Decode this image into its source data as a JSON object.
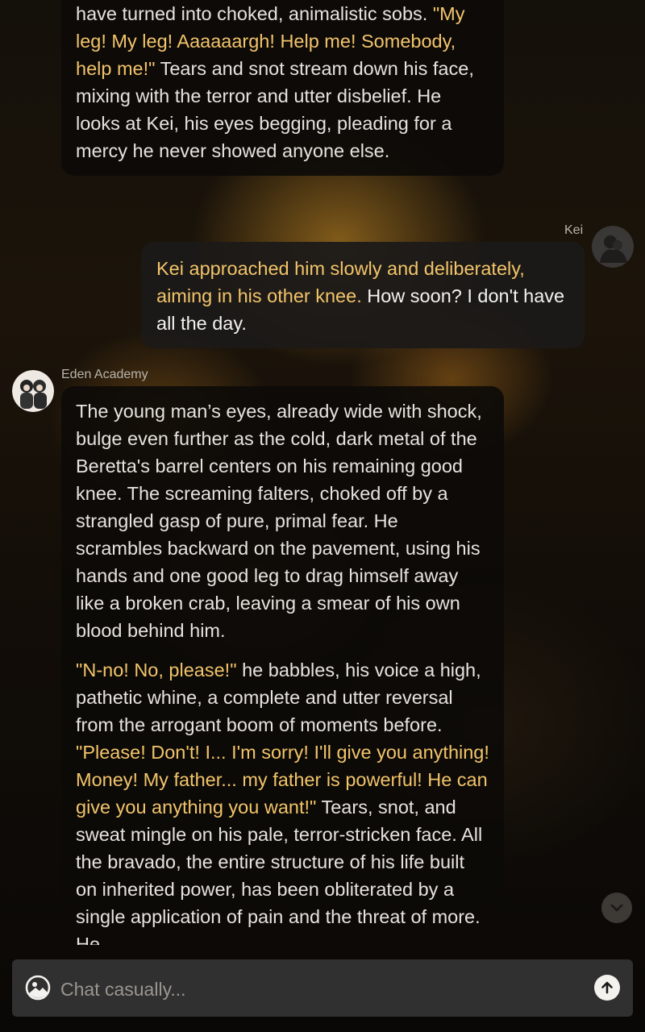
{
  "messages": [
    {
      "sender": "Eden Academy",
      "role": "bot",
      "paragraphs": [
        [
          {
            "text": "have turned into choked, animalistic sobs. ",
            "style": "narration"
          },
          {
            "text": "\"My leg! My leg! Aaaaaargh! Help me! Somebody, help me!\"",
            "style": "quote"
          },
          {
            "text": " Tears and snot stream down his face, mixing with the terror and utter disbelief. He looks at Kei, his eyes begging, pleading for a mercy he never showed anyone else.",
            "style": "narration"
          }
        ]
      ]
    },
    {
      "sender": "Kei",
      "role": "user",
      "paragraphs": [
        [
          {
            "text": "Kei approached him slowly and deliberately, aiming in his other knee.",
            "style": "quote"
          },
          {
            "text": " How soon? I don't have all the day.",
            "style": "narration"
          }
        ]
      ]
    },
    {
      "sender": "Eden Academy",
      "role": "bot",
      "paragraphs": [
        [
          {
            "text": "The young man’s eyes, already wide with shock, bulge even further as the cold, dark metal of the Beretta's barrel centers on his remaining good knee. The screaming falters, choked off by a strangled gasp of pure, primal fear. He scrambles backward on the pavement, using his hands and one good leg to drag himself away like a broken crab, leaving a smear of his own blood behind him.",
            "style": "narration"
          }
        ],
        [
          {
            "text": "\"N-no! No, please!\"",
            "style": "quote"
          },
          {
            "text": " he babbles, his voice a high, pathetic whine, a complete and utter reversal from the arrogant boom of moments before. ",
            "style": "narration"
          },
          {
            "text": "\"Please! Don't! I... I'm sorry! I'll give you anything! Money! My father... my father is powerful! He can give you anything you want!\"",
            "style": "quote"
          },
          {
            "text": " Tears, snot, and sweat mingle on his pale, terror-stricken face. All the bravado, the entire structure of his life built on inherited power, has been obliterated by a single application of pain and the threat of more. He",
            "style": "narration"
          }
        ]
      ]
    }
  ],
  "labels": {
    "user_name": "Kei",
    "bot_name": "Eden Academy"
  },
  "composer": {
    "placeholder": "Chat casually...",
    "value": ""
  },
  "icons": {
    "image_button": "image-upload-icon",
    "send_button": "arrow-up-icon",
    "scroll_down": "chevron-down-icon"
  },
  "colors": {
    "quote": "#f2c46a",
    "narration": "#e6e3df",
    "bot_bubble": "#0c0a08",
    "user_bubble": "#1c1a18",
    "composer_bg": "#313030"
  }
}
